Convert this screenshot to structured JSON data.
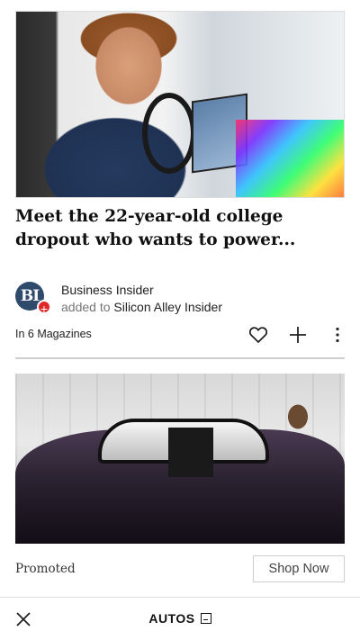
{
  "article": {
    "headline": "Meet the 22-year-old college dropout who wants to power...",
    "source": {
      "avatar_text": "BI",
      "name": "Business Insider",
      "added_prefix": "added to",
      "magazine": "Silicon Alley Insider"
    },
    "in_magazines": "In 6 Magazines",
    "icons": {
      "like": "heart-icon",
      "add": "plus-icon",
      "more": "more-vert-icon"
    }
  },
  "promo": {
    "label": "Promoted",
    "cta": "Shop Now"
  },
  "bottom_bar": {
    "title": "AUTOS",
    "close_icon": "close-icon"
  }
}
